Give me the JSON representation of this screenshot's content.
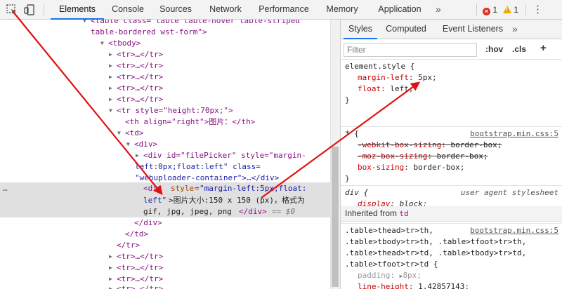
{
  "toolbar": {
    "tabs": [
      "Elements",
      "Console",
      "Sources",
      "Network",
      "Performance",
      "Memory",
      "Application"
    ],
    "more": "»",
    "errors": "1",
    "warnings": "1",
    "icons": {
      "inspect": "inspect-icon",
      "device": "device-toggle-icon",
      "menu": "kebab-menu-icon"
    }
  },
  "elements": {
    "table_tag": "<table class=\"table table-hover table-striped",
    "table_tag_cont": "table-bordered wst-form\">",
    "tbody": "<tbody>",
    "tr_collapsed": "<tr>…</tr>",
    "tr_open": "<tr style=\"height:70px;\">",
    "th": "<th align=\"right\">图片：</th>",
    "td": "<td>",
    "div": "<div>",
    "div_picker_1": "<div id=\"filePicker\" style=\"margin-",
    "div_picker_2": "left:0px;float:left\" class=",
    "div_picker_3": "\"webuploader-container\">…</div>",
    "sel_1_tag": "<div",
    "sel_1_attr": "style",
    "sel_1_val": "\"margin-left:5px;float:",
    "sel_2_val": "left\"",
    "sel_2_text": ">图片大小:150 x 150 (px)，格式为",
    "sel_3_text": "gif, jpg, jpeg, png",
    "sel_3_close": "</div>",
    "sel_3_eq": "== $0",
    "ellipsis": "…",
    "close_div": "</div>",
    "close_td": "</td>",
    "close_tr": "</tr>"
  },
  "styles": {
    "tabs": [
      "Styles",
      "Computed",
      "Event Listeners"
    ],
    "more": "»",
    "filter_placeholder": "Filter",
    "hov": ":hov",
    "cls": ".cls",
    "add": "+",
    "rules": [
      {
        "selector": "element.style {",
        "props": [
          [
            "margin-left",
            "5px"
          ],
          [
            "float",
            "left"
          ]
        ]
      },
      {
        "selector": "* {",
        "source": "bootstrap.min.css:5",
        "props": [
          [
            "-webkit-box-sizing",
            "border-box"
          ],
          [
            "-moz-box-sizing",
            "border-box"
          ],
          [
            "box-sizing",
            "border-box"
          ]
        ]
      },
      {
        "selector": "div {",
        "source": "user agent stylesheet",
        "props": [
          [
            "display",
            "block"
          ]
        ]
      }
    ],
    "inherited_label": "Inherited from",
    "inherited_tag": "td",
    "table_rule": {
      "selectors": [
        ".table>thead>tr>th,",
        ".table>tbody>tr>th, .table>tfoot>tr>th,",
        ".table>thead>tr>td, .table>tbody>tr>td,",
        ".table>tfoot>tr>td {"
      ],
      "source": "bootstrap.min.css:5",
      "props": [
        [
          "padding",
          "8px"
        ],
        [
          "line-height",
          "1.42857143"
        ]
      ]
    }
  },
  "colors": {
    "accent": "#1a73e8",
    "tag": "#881280",
    "attr": "#994500",
    "value": "#1a1aa6",
    "prop": "#c80000",
    "arrow": "#e01010"
  }
}
